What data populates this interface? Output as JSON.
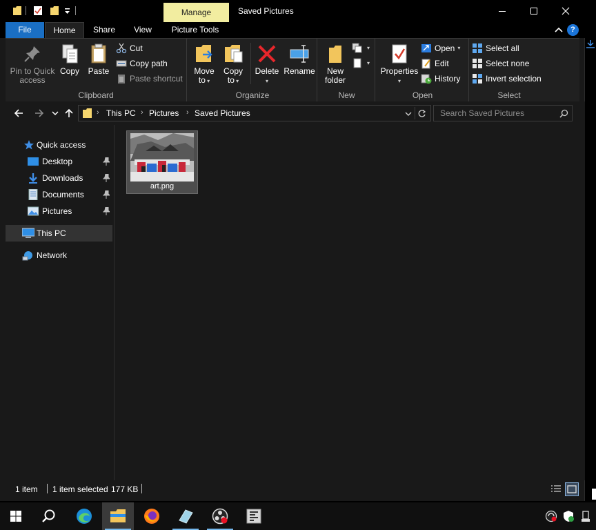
{
  "titlebar": {
    "context_tab": "Manage",
    "title": "Saved Pictures",
    "buttons": [
      "minimize-icon",
      "maximize-icon",
      "close-icon"
    ]
  },
  "tabs": {
    "file": "File",
    "home": "Home",
    "share": "Share",
    "view": "View",
    "picture_tools": "Picture Tools"
  },
  "ribbon": {
    "clipboard": {
      "label": "Clipboard",
      "pin_line1": "Pin to Quick",
      "pin_line2": "access",
      "copy": "Copy",
      "paste": "Paste",
      "cut": "Cut",
      "copy_path": "Copy path",
      "paste_shortcut": "Paste shortcut"
    },
    "organize": {
      "label": "Organize",
      "move_line1": "Move",
      "move_line2": "to",
      "copy_line1": "Copy",
      "copy_line2": "to",
      "delete": "Delete",
      "rename": "Rename"
    },
    "new": {
      "label": "New",
      "folder_line1": "New",
      "folder_line2": "folder"
    },
    "open": {
      "label": "Open",
      "properties": "Properties",
      "open": "Open",
      "edit": "Edit",
      "history": "History"
    },
    "select": {
      "label": "Select",
      "select_all": "Select all",
      "select_none": "Select none",
      "invert": "Invert selection"
    }
  },
  "address": {
    "crumbs": [
      "This PC",
      "Pictures",
      "Saved Pictures"
    ],
    "search_placeholder": "Search Saved Pictures"
  },
  "nav": {
    "quick_access": "Quick access",
    "desktop": "Desktop",
    "downloads": "Downloads",
    "documents": "Documents",
    "pictures": "Pictures",
    "this_pc": "This PC",
    "network": "Network"
  },
  "files": [
    {
      "name": "art.png"
    }
  ],
  "status": {
    "count": "1 item",
    "selected": "1 item selected",
    "size": "177 KB"
  },
  "colors": {
    "accent": "#1a6fc4",
    "manage_tab": "#f2eda0",
    "selection": "#4d4d4d"
  }
}
